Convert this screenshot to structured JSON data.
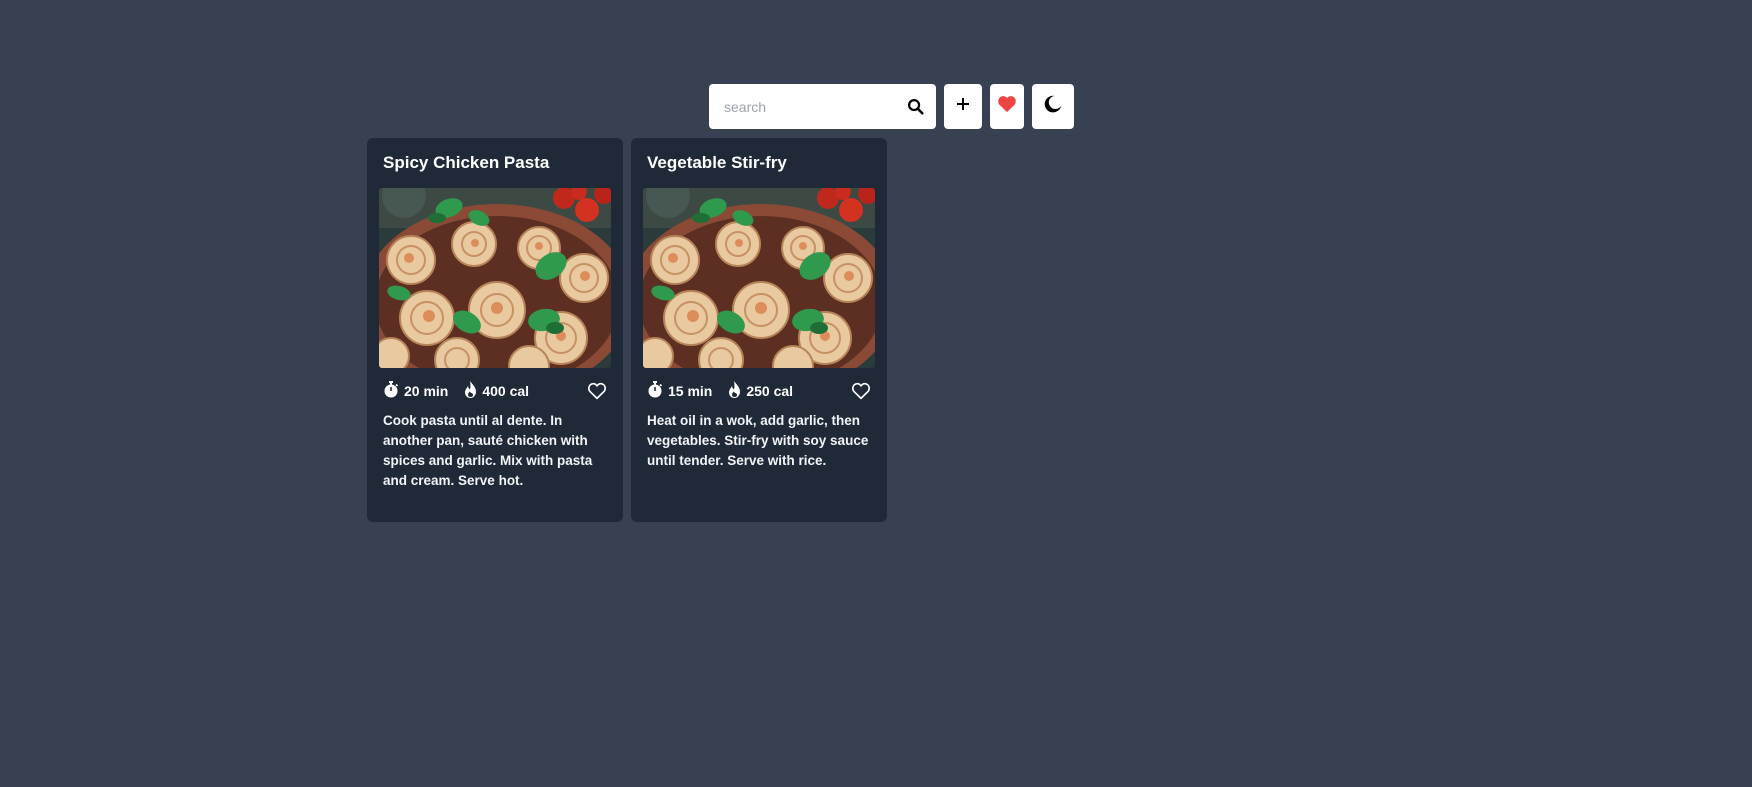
{
  "toolbar": {
    "search_placeholder": "search",
    "search_value": ""
  },
  "icons": {
    "search": "search-icon",
    "add": "plus-icon",
    "favorites": "heart-filled-icon",
    "theme": "moon-icon",
    "time": "stopwatch-icon",
    "calories": "flame-icon",
    "like": "heart-outline-icon"
  },
  "colors": {
    "background": "#374151",
    "card": "#1f2937",
    "favorite": "#ef4444"
  },
  "recipes": [
    {
      "title": "Spicy Chicken Pasta",
      "time": "20 min",
      "calories": "400 cal",
      "description": "Cook pasta until al dente. In another pan, sauté chicken with spices and garlic. Mix with pasta and cream. Serve hot."
    },
    {
      "title": "Vegetable Stir-fry",
      "time": "15 min",
      "calories": "250 cal",
      "description": "Heat oil in a wok, add garlic, then vegetables. Stir-fry with soy sauce until tender. Serve with rice."
    }
  ]
}
